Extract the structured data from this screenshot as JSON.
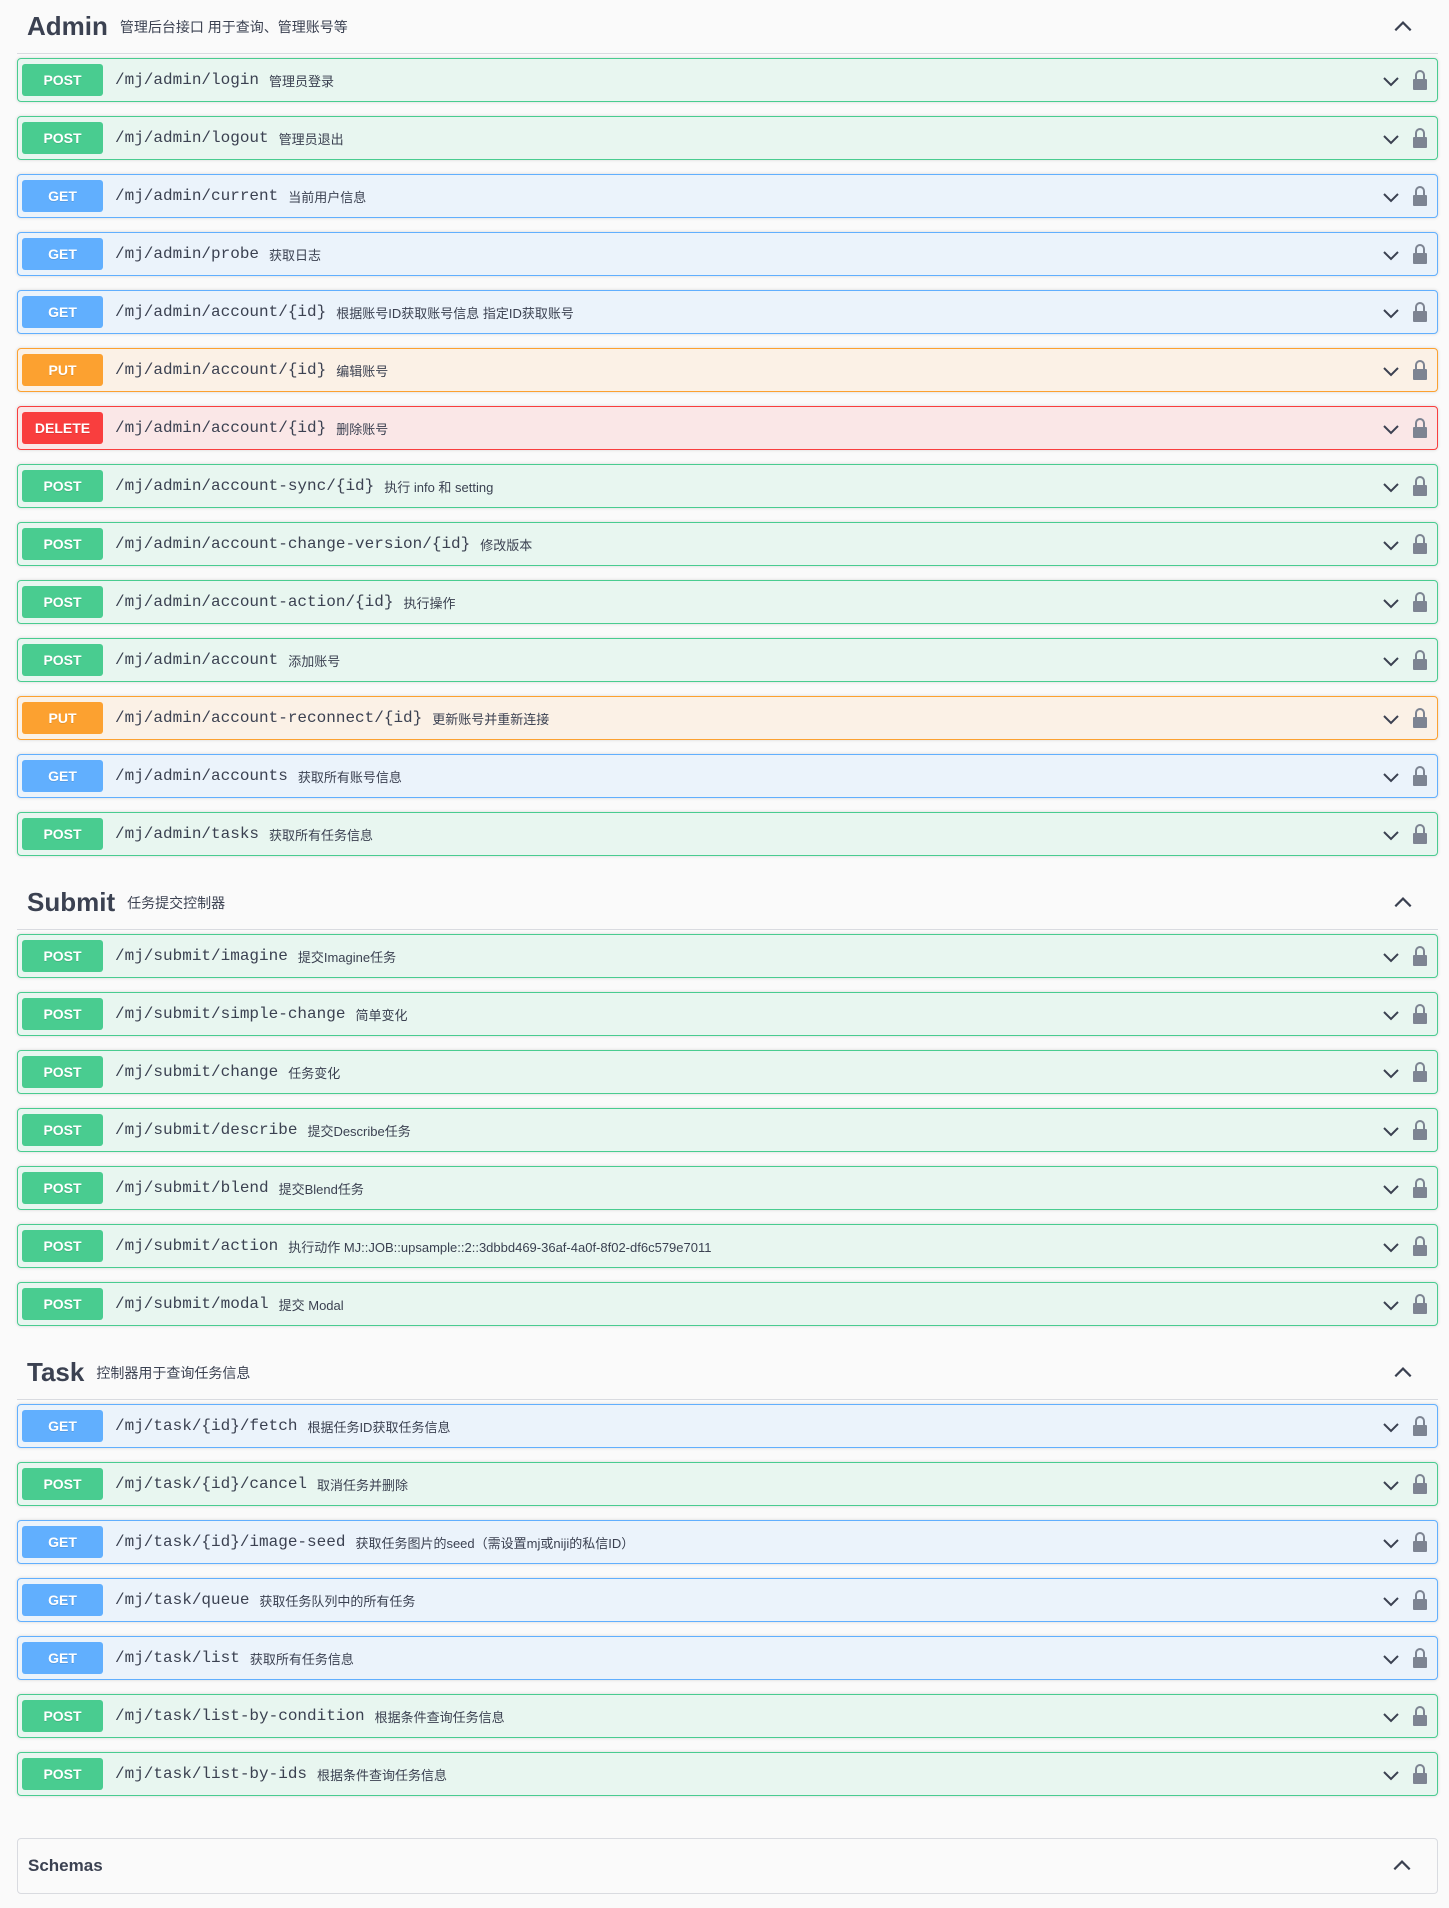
{
  "sections": [
    {
      "name": "Admin",
      "description": "管理后台接口 用于查询、管理账号等",
      "operations": [
        {
          "method": "POST",
          "path": "/mj/admin/login",
          "summary": "管理员登录"
        },
        {
          "method": "POST",
          "path": "/mj/admin/logout",
          "summary": "管理员退出"
        },
        {
          "method": "GET",
          "path": "/mj/admin/current",
          "summary": "当前用户信息"
        },
        {
          "method": "GET",
          "path": "/mj/admin/probe",
          "summary": "获取日志"
        },
        {
          "method": "GET",
          "path": "/mj/admin/account/{id}",
          "summary": "根据账号ID获取账号信息 指定ID获取账号"
        },
        {
          "method": "PUT",
          "path": "/mj/admin/account/{id}",
          "summary": "编辑账号"
        },
        {
          "method": "DELETE",
          "path": "/mj/admin/account/{id}",
          "summary": "删除账号"
        },
        {
          "method": "POST",
          "path": "/mj/admin/account-sync/{id}",
          "summary": "执行 info 和 setting"
        },
        {
          "method": "POST",
          "path": "/mj/admin/account-change-version/{id}",
          "summary": "修改版本"
        },
        {
          "method": "POST",
          "path": "/mj/admin/account-action/{id}",
          "summary": "执行操作"
        },
        {
          "method": "POST",
          "path": "/mj/admin/account",
          "summary": "添加账号"
        },
        {
          "method": "PUT",
          "path": "/mj/admin/account-reconnect/{id}",
          "summary": "更新账号并重新连接"
        },
        {
          "method": "GET",
          "path": "/mj/admin/accounts",
          "summary": "获取所有账号信息"
        },
        {
          "method": "POST",
          "path": "/mj/admin/tasks",
          "summary": "获取所有任务信息"
        }
      ]
    },
    {
      "name": "Submit",
      "description": "任务提交控制器",
      "operations": [
        {
          "method": "POST",
          "path": "/mj/submit/imagine",
          "summary": "提交Imagine任务"
        },
        {
          "method": "POST",
          "path": "/mj/submit/simple-change",
          "summary": "简单变化"
        },
        {
          "method": "POST",
          "path": "/mj/submit/change",
          "summary": "任务变化"
        },
        {
          "method": "POST",
          "path": "/mj/submit/describe",
          "summary": "提交Describe任务"
        },
        {
          "method": "POST",
          "path": "/mj/submit/blend",
          "summary": "提交Blend任务"
        },
        {
          "method": "POST",
          "path": "/mj/submit/action",
          "summary": "执行动作 MJ::JOB::upsample::2::3dbbd469-36af-4a0f-8f02-df6c579e7011"
        },
        {
          "method": "POST",
          "path": "/mj/submit/modal",
          "summary": "提交 Modal"
        }
      ]
    },
    {
      "name": "Task",
      "description": "控制器用于查询任务信息",
      "operations": [
        {
          "method": "GET",
          "path": "/mj/task/{id}/fetch",
          "summary": "根据任务ID获取任务信息"
        },
        {
          "method": "POST",
          "path": "/mj/task/{id}/cancel",
          "summary": "取消任务并删除"
        },
        {
          "method": "GET",
          "path": "/mj/task/{id}/image-seed",
          "summary": "获取任务图片的seed（需设置mj或niji的私信ID）"
        },
        {
          "method": "GET",
          "path": "/mj/task/queue",
          "summary": "获取任务队列中的所有任务"
        },
        {
          "method": "GET",
          "path": "/mj/task/list",
          "summary": "获取所有任务信息"
        },
        {
          "method": "POST",
          "path": "/mj/task/list-by-condition",
          "summary": "根据条件查询任务信息"
        },
        {
          "method": "POST",
          "path": "/mj/task/list-by-ids",
          "summary": "根据条件查询任务信息"
        }
      ]
    }
  ],
  "schemas": {
    "title": "Schemas"
  },
  "icons": {
    "section_toggle": "chevron-up-icon",
    "operation_toggle": "chevron-down-icon",
    "auth": "lock-icon"
  },
  "colors": {
    "post": "#49cc90",
    "get": "#61affe",
    "put": "#fca130",
    "delete": "#f93e3e"
  }
}
